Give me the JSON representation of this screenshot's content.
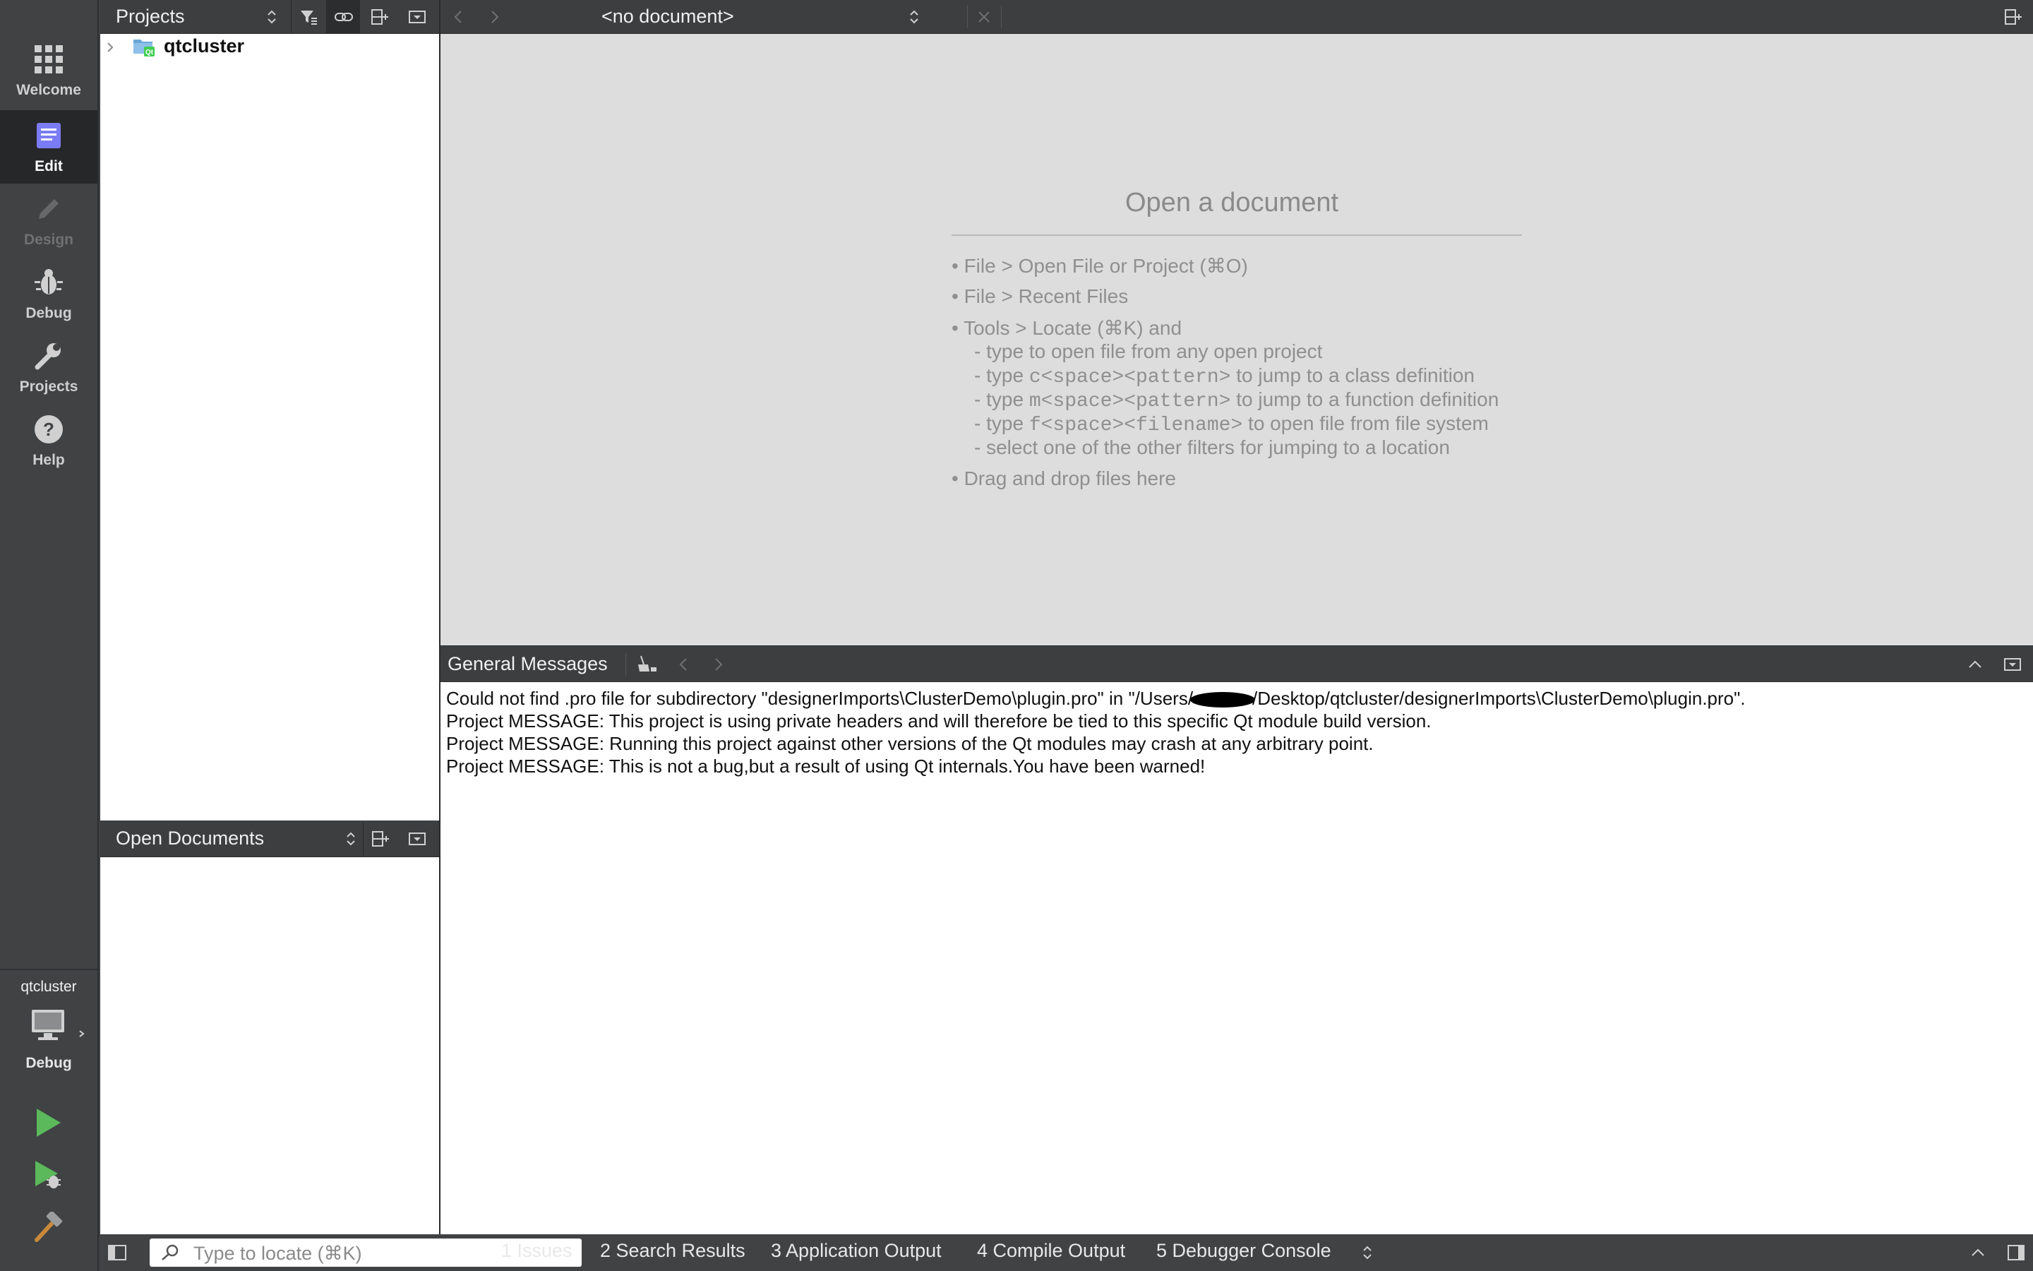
{
  "modes": [
    {
      "label": "Welcome",
      "icon": "grid-icon"
    },
    {
      "label": "Edit",
      "icon": "edit-icon"
    },
    {
      "label": "Design",
      "icon": "pencil-icon"
    },
    {
      "label": "Debug",
      "icon": "bug-icon"
    },
    {
      "label": "Projects",
      "icon": "wrench-icon"
    },
    {
      "label": "Help",
      "icon": "help-icon"
    }
  ],
  "kit": {
    "project": "qtcluster",
    "config": "Debug"
  },
  "projects_pane": {
    "title": "Projects",
    "root_item": "qtcluster"
  },
  "open_docs_pane": {
    "title": "Open Documents"
  },
  "editor_toolbar": {
    "document": "<no document>"
  },
  "editor": {
    "heading": "Open a document",
    "hints": [
      "• File > Open File or Project (⌘O)",
      "• File > Recent Files",
      "• Tools > Locate (⌘K) and"
    ],
    "sub_hints": {
      "s1": "- type to open file from any open project",
      "s2_pre": "- type ",
      "s2_code": "c<space><pattern>",
      "s2_post": " to jump to a class definition",
      "s3_pre": "- type ",
      "s3_code": "m<space><pattern>",
      "s3_post": " to jump to a function definition",
      "s4_pre": "- type ",
      "s4_code": "f<space><filename>",
      "s4_post": " to open file from file system",
      "s5": "- select one of the other filters for jumping to a location"
    },
    "drag_hint": "• Drag and drop files here"
  },
  "messages": {
    "title": "General Messages",
    "line1_pre": "Could not find .pro file for subdirectory \"designerImports\\ClusterDemo\\plugin.pro\" in \"/Users/",
    "line1_post": "/Desktop/qtcluster/designerImports\\ClusterDemo\\plugin.pro\".",
    "line2": "Project MESSAGE: This project is using private headers and will therefore be tied to this specific Qt module build version.",
    "line3": "Project MESSAGE: Running this project against other versions of the Qt modules may crash at any arbitrary point.",
    "line4": "Project MESSAGE: This is not a bug,but a result of using Qt internals.You have been warned!"
  },
  "statusbar": {
    "locate_placeholder": "Type to locate (⌘K)",
    "tabs": [
      "1  Issues",
      "2  Search Results",
      "3  Application Output",
      "4  Compile Output",
      "5  Debugger Console"
    ]
  },
  "colors": {
    "run_green": "#5bb85b",
    "accent": "#7b7cf5"
  }
}
